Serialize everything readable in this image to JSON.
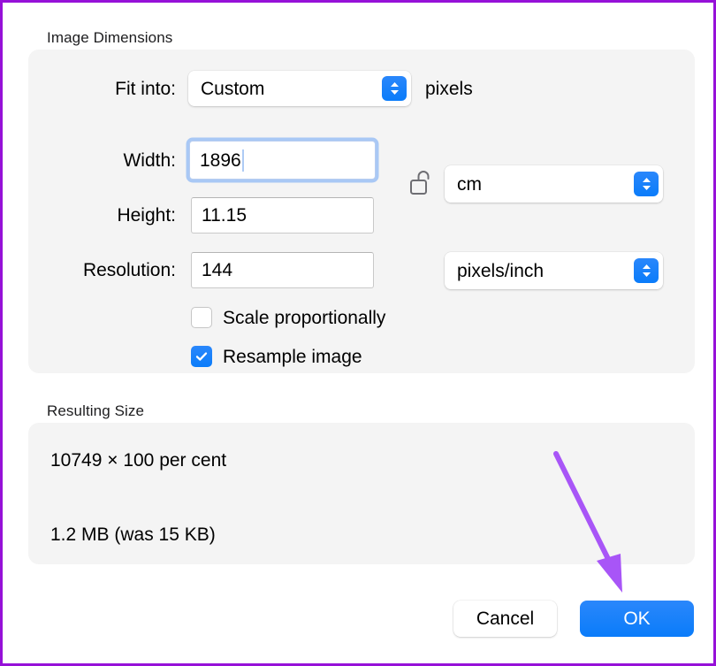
{
  "annotation": {
    "arrow_color": "#a855f7",
    "border_color": "#9610d8"
  },
  "sections": {
    "image_dimensions": {
      "title": "Image Dimensions",
      "fit_into": {
        "label": "Fit into:",
        "value": "Custom",
        "unit_suffix": "pixels",
        "stepper_icon": "chevron-up-down-icon"
      },
      "width": {
        "label": "Width:",
        "value": "1896",
        "focused": true
      },
      "height": {
        "label": "Height:",
        "value": "11.15"
      },
      "units": {
        "value": "cm",
        "lock_icon": "unlocked-padlock-icon",
        "stepper_icon": "chevron-up-down-icon"
      },
      "resolution": {
        "label": "Resolution:",
        "value": "144"
      },
      "resolution_units": {
        "value": "pixels/inch",
        "stepper_icon": "chevron-up-down-icon"
      },
      "checkboxes": [
        {
          "label": "Scale proportionally",
          "checked": false
        },
        {
          "label": "Resample image",
          "checked": true
        }
      ]
    },
    "resulting_size": {
      "title": "Resulting Size",
      "dimensions_line": "10749 × 100 per cent",
      "file_size_line": "1.2 MB (was 15 KB)"
    }
  },
  "footer": {
    "cancel_label": "Cancel",
    "ok_label": "OK"
  }
}
